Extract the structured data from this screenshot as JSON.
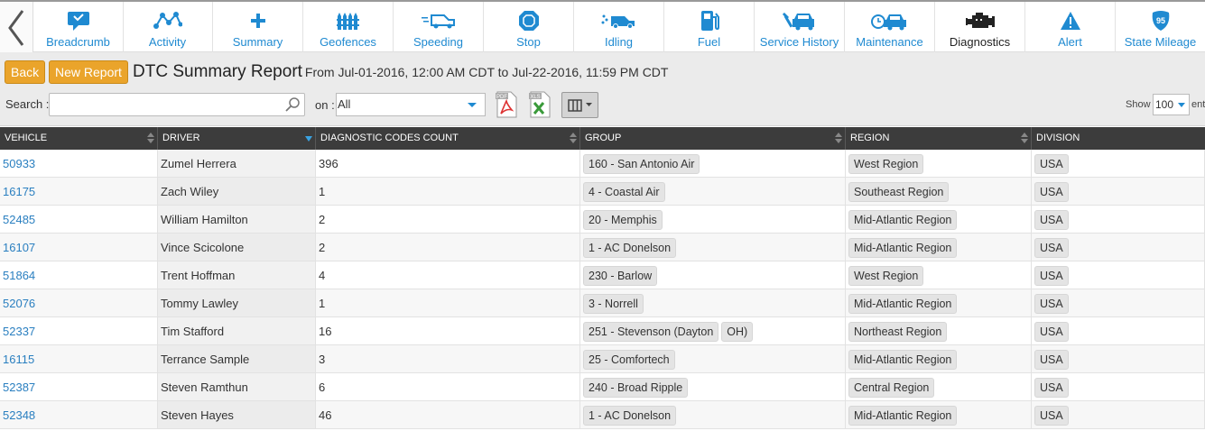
{
  "nav": {
    "items": [
      {
        "label": "Breadcrumb",
        "icon": "breadcrumb-icon",
        "active": false
      },
      {
        "label": "Activity",
        "icon": "activity-icon",
        "active": false
      },
      {
        "label": "Summary",
        "icon": "plus-icon",
        "active": false
      },
      {
        "label": "Geofences",
        "icon": "fence-icon",
        "active": false
      },
      {
        "label": "Speeding",
        "icon": "speeding-truck-icon",
        "active": false
      },
      {
        "label": "Stop",
        "icon": "stop-hexagon-icon",
        "active": false
      },
      {
        "label": "Idling",
        "icon": "idling-truck-icon",
        "active": false
      },
      {
        "label": "Fuel",
        "icon": "fuel-pump-icon",
        "active": false
      },
      {
        "label": "Service History",
        "icon": "service-wrench-car-icon",
        "active": false
      },
      {
        "label": "Maintenance",
        "icon": "maintenance-car-icon",
        "active": false
      },
      {
        "label": "Diagnostics",
        "icon": "engine-icon",
        "active": true
      },
      {
        "label": "Alert",
        "icon": "alert-icon",
        "active": false
      },
      {
        "label": "State Mileage",
        "icon": "interstate-shield-icon",
        "active": false
      }
    ],
    "shield_number": "95"
  },
  "toolbar": {
    "back_label": "Back",
    "new_report_label": "New Report",
    "report_title": "DTC Summary Report",
    "date_range": "From Jul-01-2016, 12:00 AM CDT to Jul-22-2016, 11:59 PM CDT",
    "search_label": "Search :",
    "search_value": "",
    "on_label": "on :",
    "on_selected": "All",
    "pdf_label": "PDF",
    "xls_label": "XLS",
    "show_label": "Show",
    "show_selected": "100",
    "entries_label": "ent"
  },
  "table": {
    "columns": [
      "VEHICLE",
      "DRIVER",
      "DIAGNOSTIC CODES COUNT",
      "GROUP",
      "REGION",
      "DIVISION"
    ],
    "rows": [
      {
        "vehicle": "50933",
        "driver": "Zumel Herrera",
        "count": "396",
        "group": [
          "160 - San Antonio Air"
        ],
        "region": "West Region",
        "division": "USA"
      },
      {
        "vehicle": "16175",
        "driver": "Zach Wiley",
        "count": "1",
        "group": [
          "4 - Coastal Air"
        ],
        "region": "Southeast Region",
        "division": "USA"
      },
      {
        "vehicle": "52485",
        "driver": "William Hamilton",
        "count": "2",
        "group": [
          "20 - Memphis"
        ],
        "region": "Mid-Atlantic Region",
        "division": "USA"
      },
      {
        "vehicle": "16107",
        "driver": "Vince Scicolone",
        "count": "2",
        "group": [
          "1 - AC Donelson"
        ],
        "region": "Mid-Atlantic Region",
        "division": "USA"
      },
      {
        "vehicle": "51864",
        "driver": "Trent Hoffman",
        "count": "4",
        "group": [
          "230 - Barlow"
        ],
        "region": "West Region",
        "division": "USA"
      },
      {
        "vehicle": "52076",
        "driver": "Tommy Lawley",
        "count": "1",
        "group": [
          "3 - Norrell"
        ],
        "region": "Mid-Atlantic Region",
        "division": "USA"
      },
      {
        "vehicle": "52337",
        "driver": "Tim Stafford",
        "count": "16",
        "group": [
          "251 - Stevenson (Dayton",
          "OH)"
        ],
        "region": "Northeast Region",
        "division": "USA"
      },
      {
        "vehicle": "16115",
        "driver": "Terrance Sample",
        "count": "3",
        "group": [
          "25 - Comfortech"
        ],
        "region": "Mid-Atlantic Region",
        "division": "USA"
      },
      {
        "vehicle": "52387",
        "driver": "Steven Ramthun",
        "count": "6",
        "group": [
          "240 - Broad Ripple"
        ],
        "region": "Central Region",
        "division": "USA"
      },
      {
        "vehicle": "52348",
        "driver": "Steven Hayes",
        "count": "46",
        "group": [
          "1 - AC Donelson"
        ],
        "region": "Mid-Atlantic Region",
        "division": "USA"
      }
    ]
  },
  "colors": {
    "accent_blue": "#1f8ad1",
    "link_blue": "#2a7fc0",
    "button_orange": "#eaa42b",
    "header_dark": "#3c3c3c"
  }
}
